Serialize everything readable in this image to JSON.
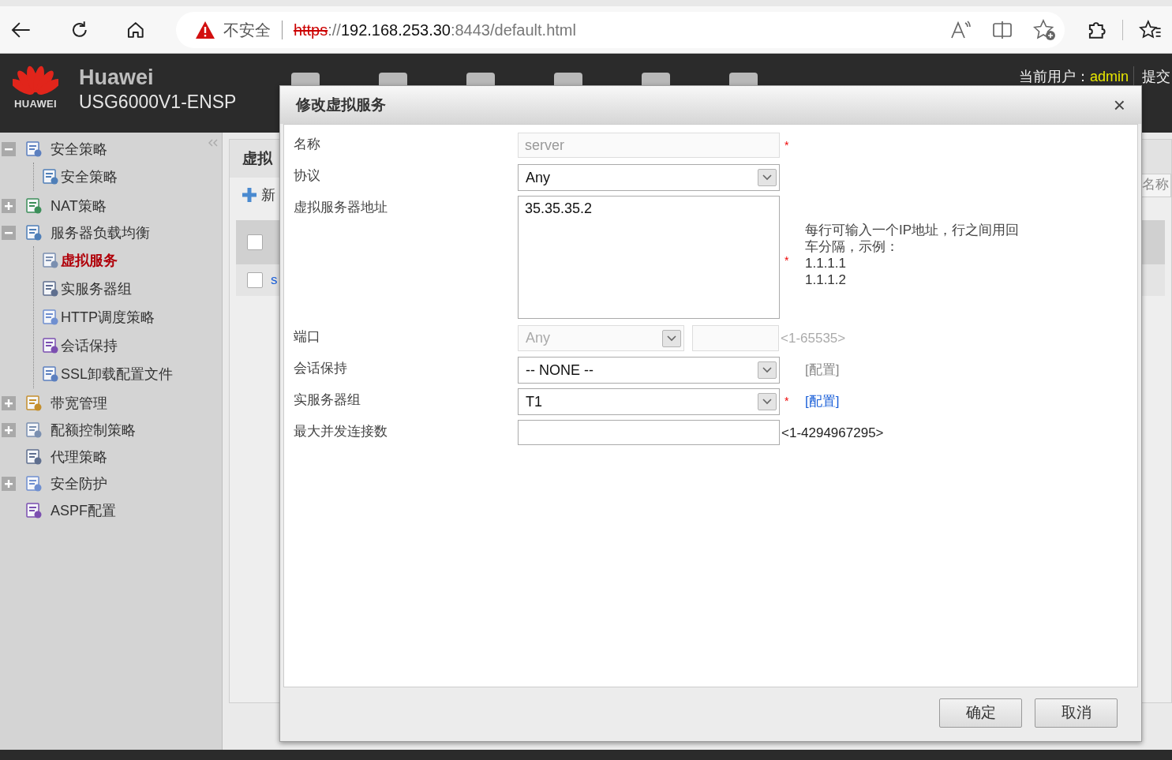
{
  "browser": {
    "security_label": "不安全",
    "url_scheme": "https",
    "url_sep": "://",
    "url_host": "192.168.253.30",
    "url_rest": ":8443/default.html"
  },
  "header": {
    "brand": "HUAWEI",
    "title": "Huawei",
    "model": "USG6000V1-ENSP",
    "user_label": "当前用户：",
    "user": "admin",
    "commit": "提交"
  },
  "sidebar": {
    "items": [
      {
        "label": "安全策略",
        "expanded": true,
        "children": [
          {
            "label": "安全策略",
            "selected": false
          }
        ]
      },
      {
        "label": "NAT策略",
        "expanded": false
      },
      {
        "label": "服务器负载均衡",
        "expanded": true,
        "children": [
          {
            "label": "虚拟服务",
            "selected": true
          },
          {
            "label": "实服务器组",
            "selected": false
          },
          {
            "label": "HTTP调度策略",
            "selected": false
          },
          {
            "label": "会话保持",
            "selected": false
          },
          {
            "label": "SSL卸载配置文件",
            "selected": false
          }
        ]
      },
      {
        "label": "带宽管理",
        "expanded": false
      },
      {
        "label": "配额控制策略",
        "expanded": false
      },
      {
        "label": "代理策略"
      },
      {
        "label": "安全防护",
        "expanded": false
      },
      {
        "label": "ASPF配置"
      }
    ]
  },
  "background_panel": {
    "title": "虚拟",
    "new_button": "新",
    "row_link": "s",
    "header_checked": false,
    "row_checked": false,
    "search_placeholder": "名称"
  },
  "dialog": {
    "title": "修改虚拟服务",
    "close": "×",
    "required_mark": "*",
    "fields": [
      {
        "kind": "text",
        "label": "名称",
        "value": "server",
        "disabled": true,
        "required": true
      },
      {
        "kind": "select",
        "label": "协议",
        "value": "Any",
        "disabled": false,
        "required": false
      },
      {
        "kind": "textarea",
        "label": "虚拟服务器地址",
        "value": "35.35.35.2",
        "required": true,
        "help": "每行可输入一个IP地址，行之间用回车分隔，示例：",
        "examples": [
          "1.1.1.1",
          "1.1.1.2"
        ]
      },
      {
        "kind": "port",
        "label": "端口",
        "value": "Any",
        "disabled": true,
        "required": false,
        "range": "<1-65535>"
      },
      {
        "kind": "select",
        "label": "会话保持",
        "value": "-- NONE --",
        "disabled": false,
        "required": false,
        "link": "[配置]",
        "link_disabled": true
      },
      {
        "kind": "select",
        "label": "实服务器组",
        "value": "T1",
        "disabled": false,
        "required": true,
        "link": "[配置]",
        "link_disabled": false
      },
      {
        "kind": "text",
        "label": "最大并发连接数",
        "disabled": false,
        "required": false,
        "range": "<1-4294967295>"
      }
    ],
    "buttons": [
      "确定",
      "取消"
    ]
  }
}
